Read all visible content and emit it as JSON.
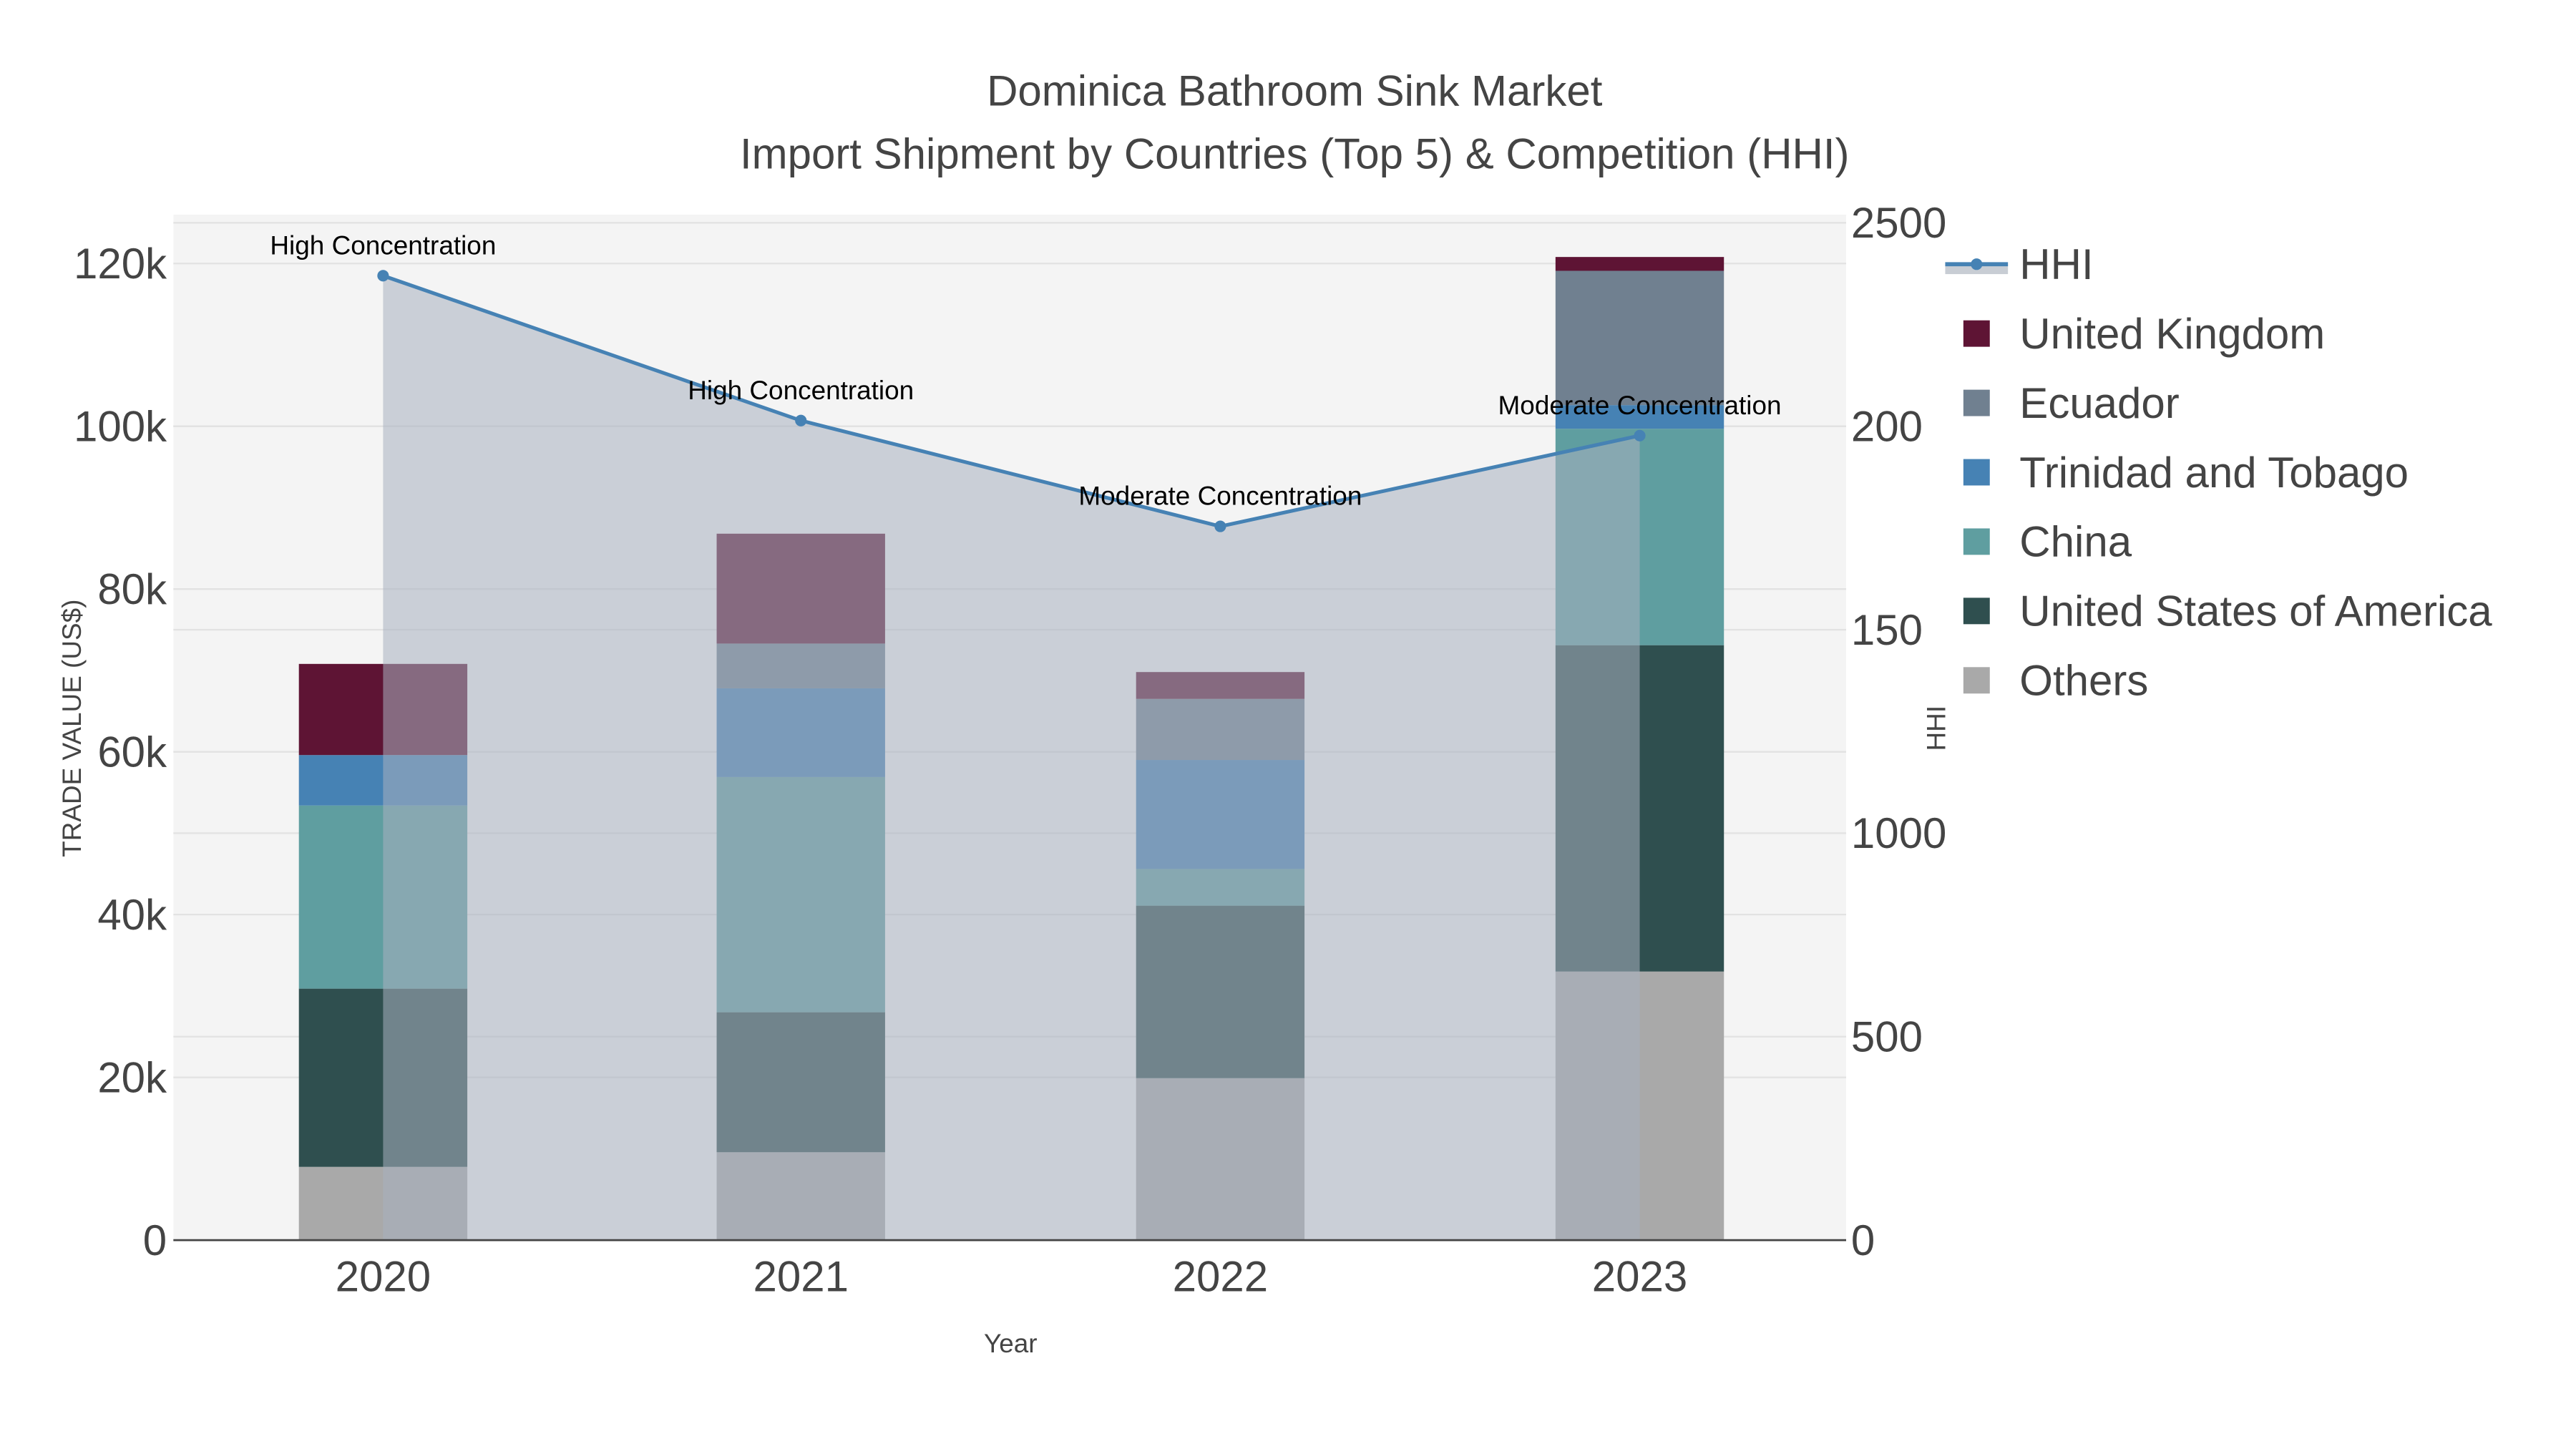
{
  "chart_data": {
    "type": "bar",
    "title": "Dominica Bathroom Sink Market",
    "subtitle": "Import Shipment by Countries (Top 5) & Competition (HHI)",
    "xlabel": "Year",
    "ylabel": "TRADE VALUE (US$)",
    "y2label": "HHI",
    "categories": [
      "2020",
      "2021",
      "2022",
      "2023"
    ],
    "ylim": [
      0,
      126000
    ],
    "y2lim": [
      0,
      2520
    ],
    "yticks": [
      {
        "v": 0,
        "label": "0"
      },
      {
        "v": 20000,
        "label": "20k"
      },
      {
        "v": 40000,
        "label": "40k"
      },
      {
        "v": 60000,
        "label": "60k"
      },
      {
        "v": 80000,
        "label": "80k"
      },
      {
        "v": 100000,
        "label": "100k"
      },
      {
        "v": 120000,
        "label": "120k"
      }
    ],
    "y2ticks": [
      {
        "v": 0,
        "label": "0"
      },
      {
        "v": 500,
        "label": "500"
      },
      {
        "v": 1000,
        "label": "1000"
      },
      {
        "v": 1500,
        "label": "150"
      },
      {
        "v": 2000,
        "label": "200"
      },
      {
        "v": 2500,
        "label": "2500"
      }
    ],
    "series": [
      {
        "name": "Others",
        "color": "#a9a9a9",
        "values": [
          9000,
          10800,
          19900,
          33000
        ]
      },
      {
        "name": "United States of America",
        "color": "#2f4f4f",
        "values": [
          21900,
          17200,
          21200,
          40100
        ]
      },
      {
        "name": "China",
        "color": "#5f9ea0",
        "values": [
          22500,
          28900,
          4500,
          26600
        ]
      },
      {
        "name": "Trinidad and Tobago",
        "color": "#4682b4",
        "values": [
          6200,
          10900,
          13400,
          2900
        ]
      },
      {
        "name": "Ecuador",
        "color": "#708090",
        "values": [
          0,
          5500,
          7500,
          16500
        ]
      },
      {
        "name": "United Kingdom",
        "color": "#5e1434",
        "values": [
          11200,
          13500,
          3300,
          1700
        ]
      }
    ],
    "line": {
      "name": "HHI",
      "color": "#4682b4",
      "values": [
        2370,
        2014,
        1754,
        1977
      ],
      "annotations": [
        "High Concentration",
        "High Concentration",
        "Moderate Concentration",
        "Moderate Concentration"
      ]
    },
    "legend": [
      "HHI",
      "United Kingdom",
      "Ecuador",
      "Trinidad and Tobago",
      "China",
      "United States of America",
      "Others"
    ],
    "legend_position": "right",
    "grid": true
  }
}
